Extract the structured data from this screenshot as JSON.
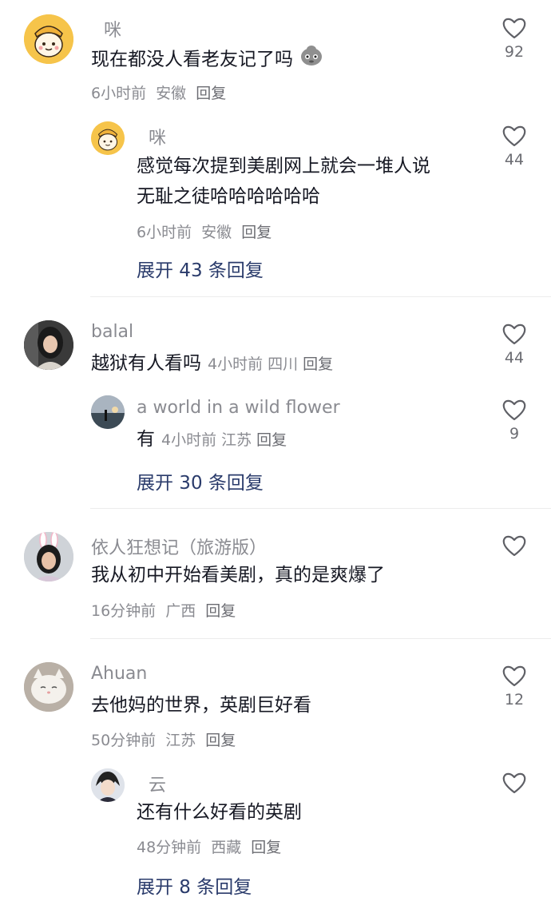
{
  "comments": [
    {
      "name": "咪",
      "text": "现在都没人看老友记了吗",
      "time": "6小时前",
      "location": "安徽",
      "reply_label": "回复",
      "likes": "92",
      "avatar_icon": "cartoon-dog-avatar",
      "reply": {
        "name": "咪",
        "text_line1": "感觉每次提到美剧网上就会一堆人说",
        "text_line2": "无耻之徒哈哈哈哈哈哈",
        "time": "6小时前",
        "location": "安徽",
        "reply_label": "回复",
        "likes": "44",
        "avatar_icon": "cartoon-dog-avatar"
      },
      "expand_label": "展开 43 条回复"
    },
    {
      "name": "balal",
      "text": "越狱有人看吗",
      "time": "4小时前",
      "location": "四川",
      "reply_label": "回复",
      "likes": "44",
      "avatar_icon": "girl-photo-avatar",
      "reply": {
        "name": "a world in a wild flower",
        "text": "有",
        "time": "4小时前",
        "location": "江苏",
        "reply_label": "回复",
        "likes": "9",
        "avatar_icon": "sunset-landscape-avatar"
      },
      "expand_label": "展开 30 条回复"
    },
    {
      "name": "依人狂想记（旅游版）",
      "text": "我从初中开始看美剧，真的是爽爆了",
      "time": "16分钟前",
      "location": "广西",
      "reply_label": "回复",
      "likes": "",
      "avatar_icon": "girl-bunny-ears-avatar"
    },
    {
      "name": "Ahuan",
      "text": "去他妈的世界，英剧巨好看",
      "time": "50分钟前",
      "location": "江苏",
      "reply_label": "回复",
      "likes": "12",
      "avatar_icon": "white-cat-avatar",
      "reply": {
        "name": "云",
        "text": "还有什么好看的英剧",
        "time": "48分钟前",
        "location": "西藏",
        "reply_label": "回复",
        "likes": "",
        "avatar_icon": "anime-character-avatar"
      },
      "expand_label": "展开 8 条回复"
    }
  ],
  "colors": {
    "name": "#8a8b91",
    "text": "#161823",
    "meta": "#8a8b91",
    "expand": "#2a3b6b",
    "heart": "#5f6066",
    "divider": "#ececec"
  }
}
